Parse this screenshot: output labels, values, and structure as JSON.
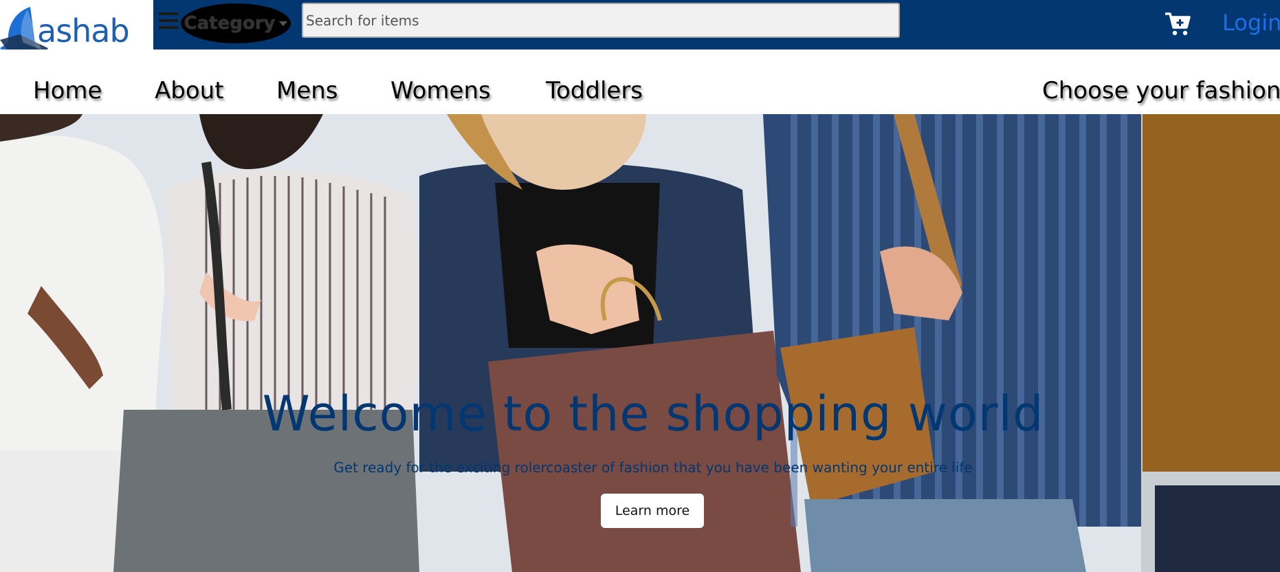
{
  "logo": {
    "text": "ashab",
    "brand_color": "#1d5fb0"
  },
  "topbar": {
    "background": "#023771",
    "menu_icon": "hamburger-icon",
    "category_label": "Category",
    "category_icon": "caret-down-icon",
    "search_placeholder": "Search for items",
    "search_value": "",
    "cart_icon": "cart-plus-icon",
    "login_label": "Login"
  },
  "nav": {
    "items": [
      "Home",
      "About",
      "Mens",
      "Womens",
      "Toddlers"
    ],
    "tagline": "Choose your fashion"
  },
  "hero": {
    "title": "Welcome to the shopping world",
    "subtitle": "Get ready for the exciting rolercoaster of fashion that you have been wanting your entire life",
    "button_label": "Learn more",
    "text_color": "#023771"
  }
}
